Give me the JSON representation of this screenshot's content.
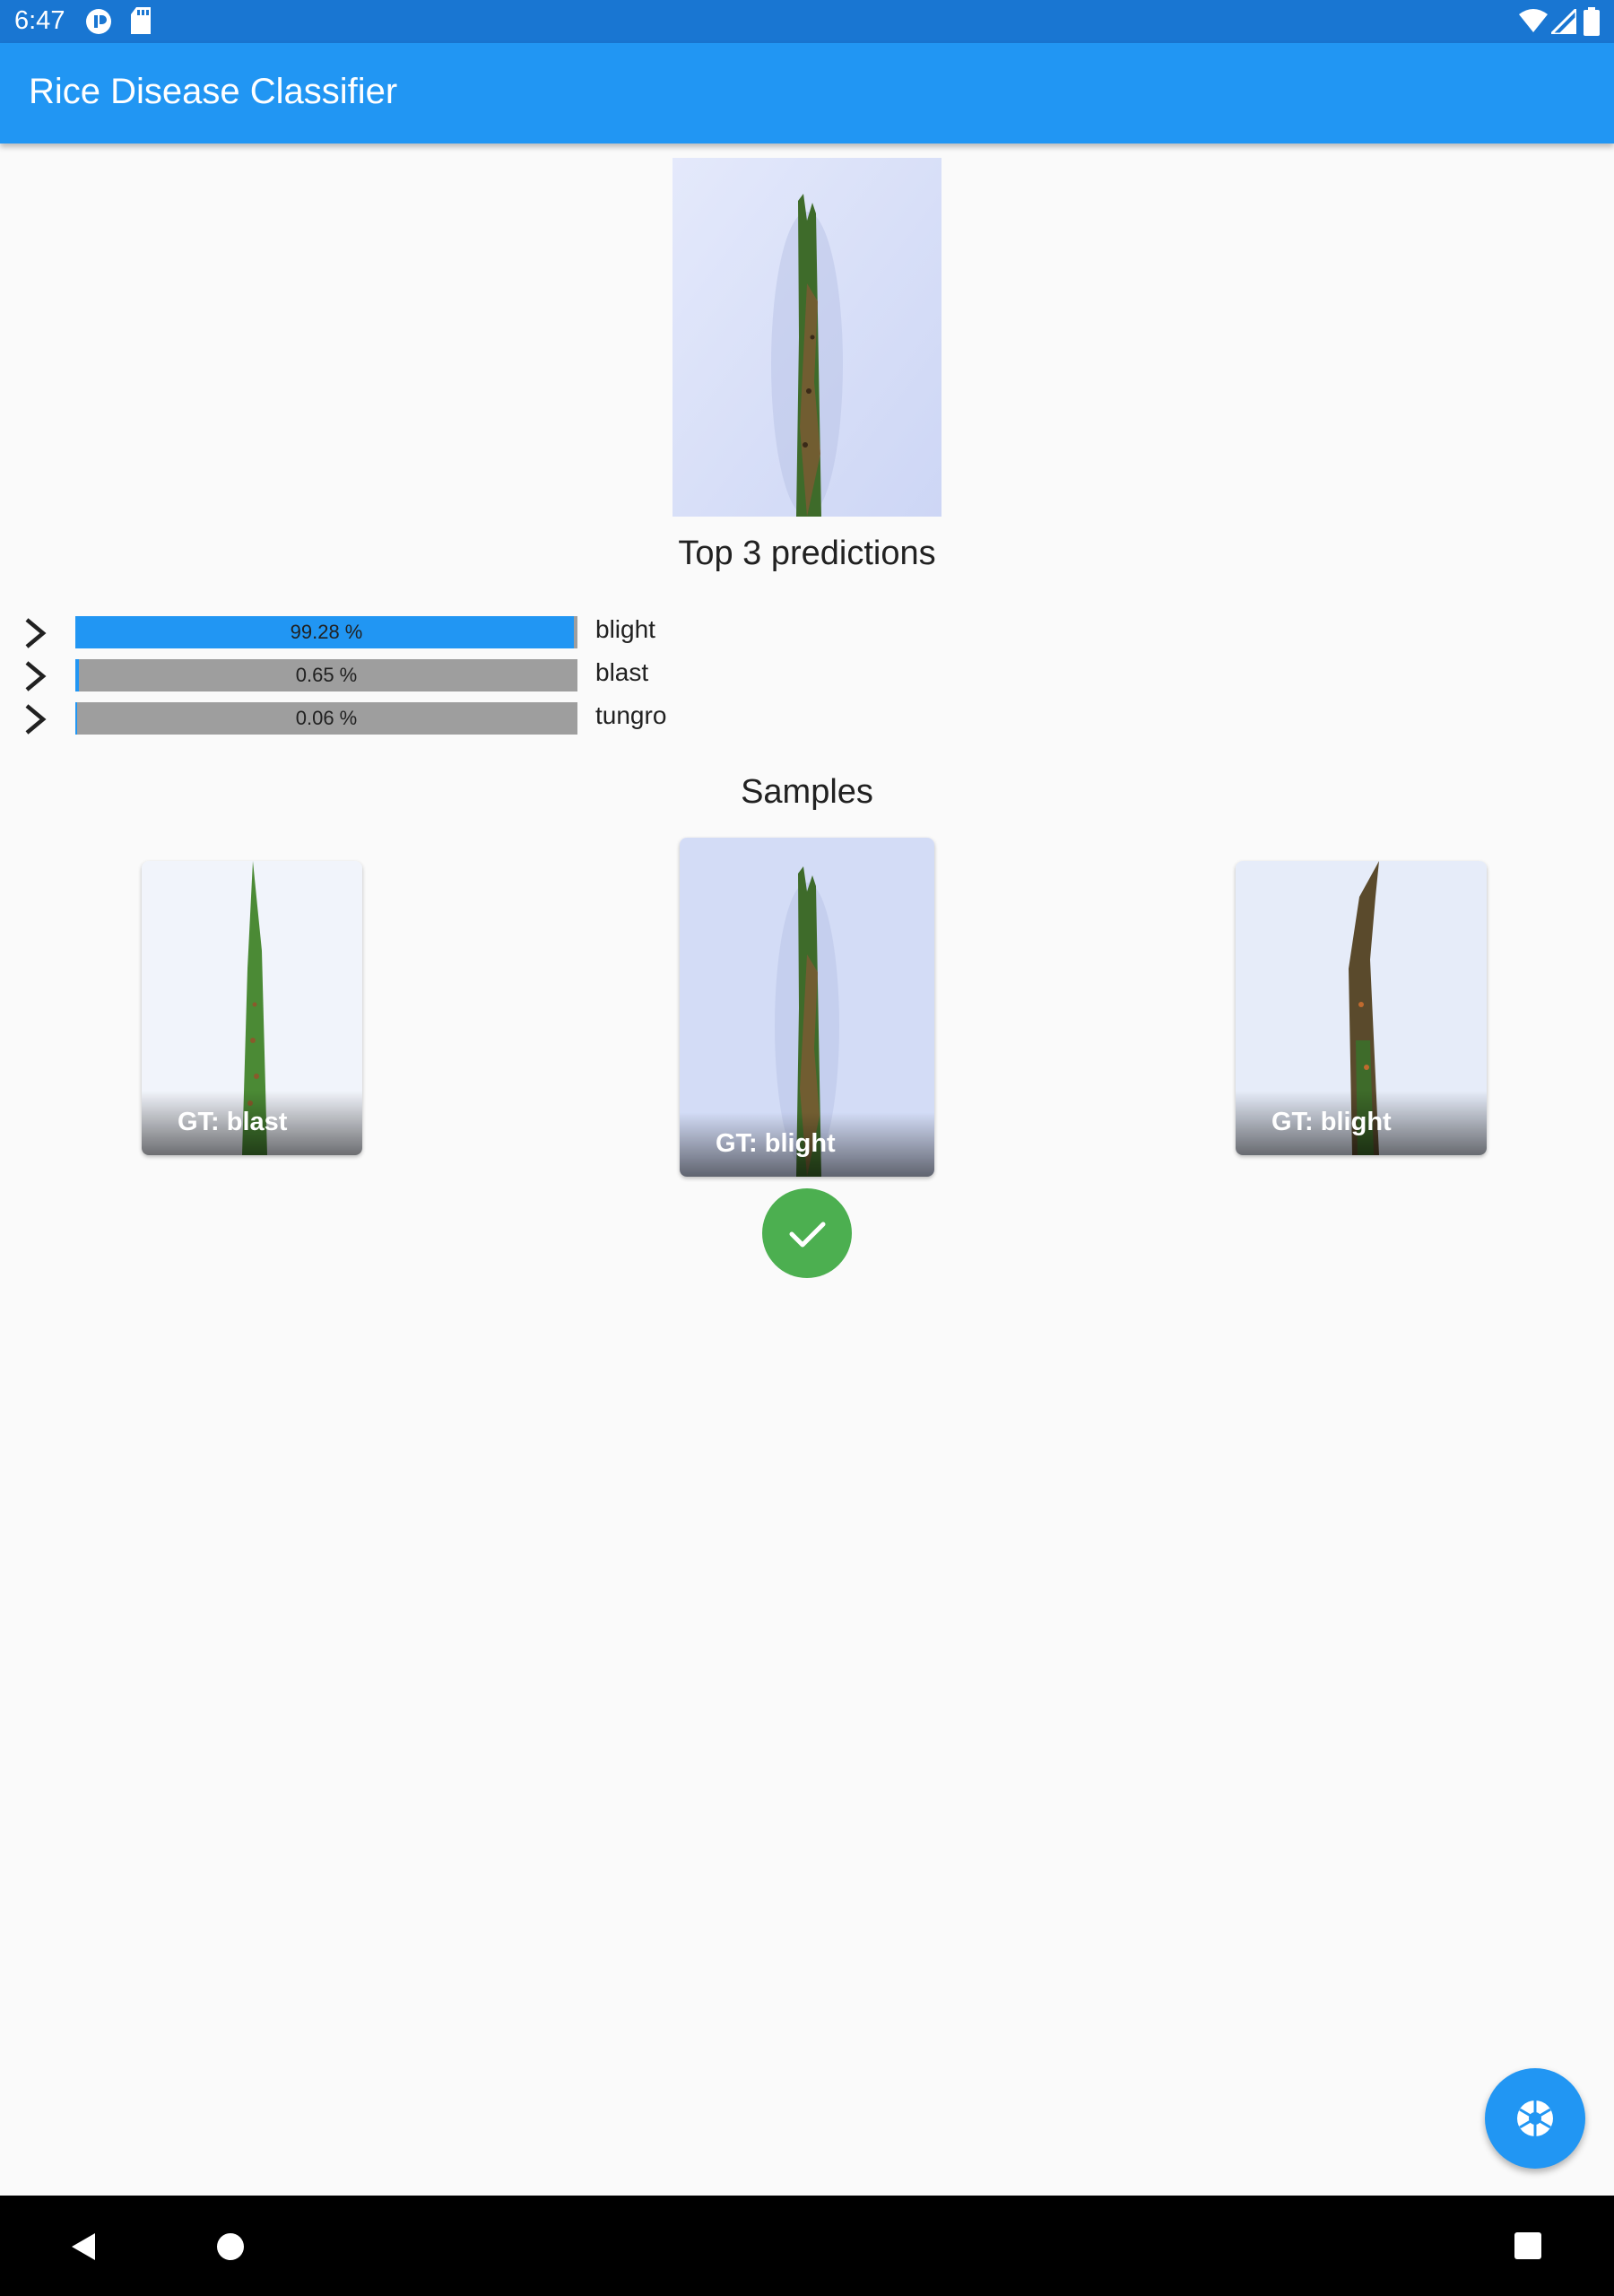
{
  "status_bar": {
    "time": "6:47"
  },
  "app_bar": {
    "title": "Rice Disease Classifier"
  },
  "predictions": {
    "title": "Top 3 predictions",
    "items": [
      {
        "label": "blight",
        "value_text": "99.28 %",
        "value": 99.28
      },
      {
        "label": "blast",
        "value_text": "0.65 %",
        "value": 0.65
      },
      {
        "label": "tungro",
        "value_text": "0.06 %",
        "value": 0.06
      }
    ]
  },
  "samples": {
    "title": "Samples",
    "cards": [
      {
        "caption": "GT: blast"
      },
      {
        "caption": "GT: blight"
      },
      {
        "caption": "GT: blight"
      }
    ]
  },
  "colors": {
    "app_bar": "#2196f3",
    "status_bar": "#1976d2",
    "bar_fill": "#2196f3",
    "bar_track": "#9e9e9e",
    "check": "#4caf50"
  },
  "icons": {
    "status": [
      "media-icon",
      "sd-card-icon",
      "wifi-icon",
      "signal-icon",
      "battery-icon"
    ],
    "prediction_expand": "chevron-right-icon",
    "correct": "check-icon",
    "fab": "camera-shutter-icon",
    "navigation": [
      "back-icon",
      "home-icon",
      "recents-icon"
    ]
  }
}
